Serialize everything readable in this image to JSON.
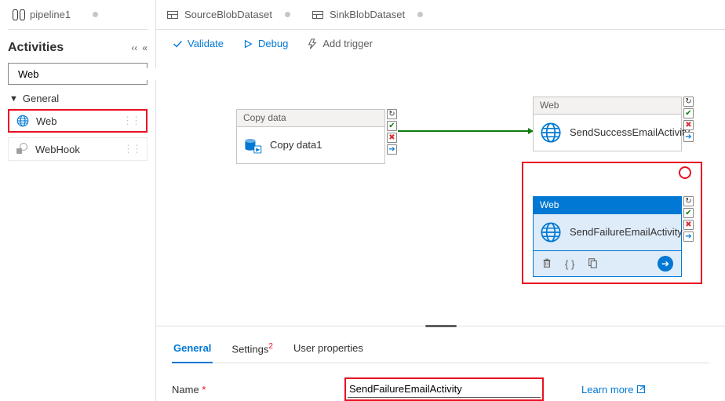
{
  "tabs": {
    "pipeline": "pipeline1",
    "ds1": "SourceBlobDataset",
    "ds2": "SinkBlobDataset"
  },
  "activities": {
    "title": "Activities",
    "search_value": "Web",
    "group": "General",
    "web_label": "Web",
    "webhook_label": "WebHook"
  },
  "toolbar": {
    "validate": "Validate",
    "debug": "Debug",
    "trigger": "Add trigger"
  },
  "nodes": {
    "copy_type": "Copy data",
    "copy_name": "Copy data1",
    "web_type": "Web",
    "success_name": "SendSuccessEmailActivity",
    "failure_name": "SendFailureEmailActivity"
  },
  "props": {
    "tab_general": "General",
    "tab_settings": "Settings",
    "settings_badge": "2",
    "tab_user": "User properties",
    "name_label": "Name",
    "name_value": "SendFailureEmailActivity",
    "learn_more": "Learn more"
  }
}
